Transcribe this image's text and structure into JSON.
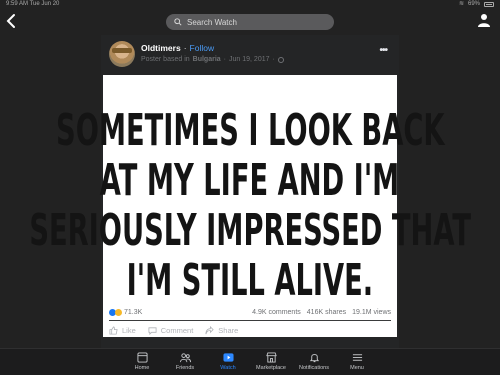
{
  "status_bar": {
    "time": "9:59 AM",
    "date": "Tue Jun 20",
    "battery": "69%"
  },
  "search": {
    "placeholder": "Search Watch"
  },
  "post": {
    "author": "Oldtimers",
    "follow_label": "Follow",
    "separator": "·",
    "meta_prefix": "Poster based in",
    "location": "Bulgaria",
    "date": "Jun 19, 2017",
    "image_text": [
      "SOMETIMES I LOOK BACK",
      "AT MY LIFE AND I'M",
      "SERIOUSLY IMPRESSED THAT",
      "I'M STILL ALIVE."
    ],
    "reaction_count": "71.3K",
    "comments": "4.9K comments",
    "shares": "416K shares",
    "views": "19.1M views",
    "like_label": "Like",
    "comment_label": "Comment",
    "share_label": "Share"
  },
  "tabbar": {
    "items": [
      {
        "label": "Home",
        "icon": "home-icon"
      },
      {
        "label": "Friends",
        "icon": "friends-icon"
      },
      {
        "label": "Watch",
        "icon": "watch-icon",
        "active": true
      },
      {
        "label": "Marketplace",
        "icon": "marketplace-icon"
      },
      {
        "label": "Notifications",
        "icon": "bell-icon"
      },
      {
        "label": "Menu",
        "icon": "menu-icon"
      }
    ]
  },
  "colors": {
    "accent": "#2d88ff",
    "follow": "#4a9bf5",
    "background": "#222222",
    "card": "#242526"
  }
}
